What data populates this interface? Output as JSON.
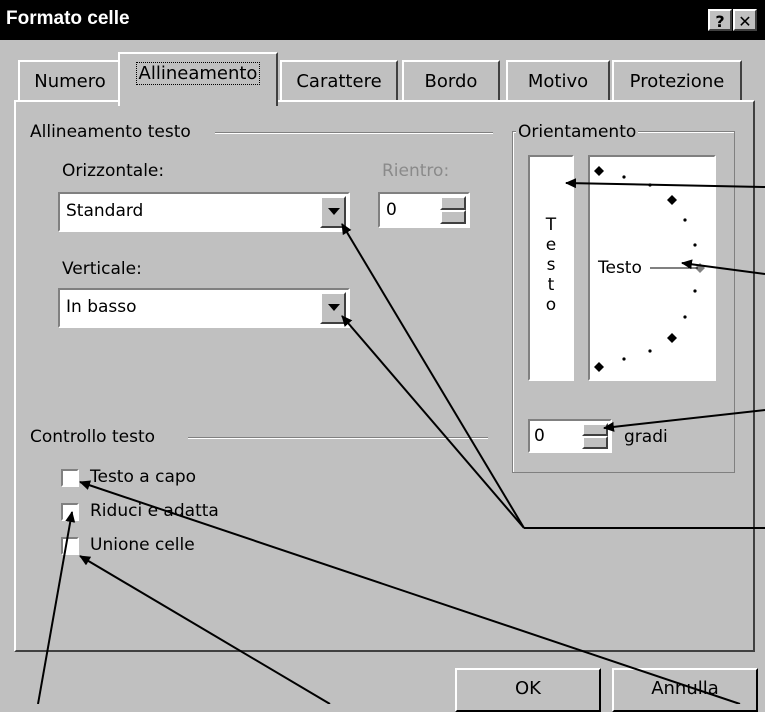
{
  "window": {
    "title": "Formato celle",
    "help_label": "?",
    "close_label": "✕"
  },
  "tabs": [
    {
      "label": "Numero",
      "active": false
    },
    {
      "label": "Allineamento",
      "active": true
    },
    {
      "label": "Carattere",
      "active": false
    },
    {
      "label": "Bordo",
      "active": false
    },
    {
      "label": "Motivo",
      "active": false
    },
    {
      "label": "Protezione",
      "active": false
    }
  ],
  "alignment": {
    "group_label": "Allineamento testo",
    "horizontal_label": "Orizzontale:",
    "horizontal_value": "Standard",
    "indent_label": "Rientro:",
    "indent_value": "0",
    "vertical_label": "Verticale:",
    "vertical_value": "In basso"
  },
  "orientation": {
    "group_label": "Orientamento",
    "vertical_text": [
      "T",
      "e",
      "s",
      "t",
      "o"
    ],
    "dial_text": "Testo",
    "degrees_value": "0",
    "degrees_label": "gradi"
  },
  "text_control": {
    "group_label": "Controllo testo",
    "checkboxes": [
      {
        "label": "Testo a capo",
        "checked": false
      },
      {
        "label": "Riduci e adatta",
        "checked": false
      },
      {
        "label": "Unione celle",
        "checked": false
      }
    ]
  },
  "buttons": {
    "ok": "OK",
    "cancel": "Annulla"
  },
  "colors": {
    "titlebar": "#000000",
    "dialog": "#c0c0c0",
    "field": "#ffffff"
  }
}
